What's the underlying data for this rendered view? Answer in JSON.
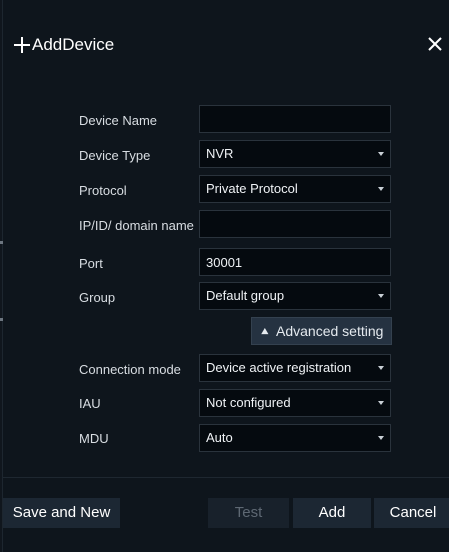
{
  "dialog": {
    "title": "AddDevice",
    "plus_icon": "plus-icon",
    "close_icon": "close-icon"
  },
  "form": {
    "device_name": {
      "label": "Device Name",
      "value": ""
    },
    "device_type": {
      "label": "Device Type",
      "value": "NVR"
    },
    "protocol": {
      "label": "Protocol",
      "value": "Private Protocol"
    },
    "ip_domain": {
      "label": "IP/ID/ domain name",
      "value": ""
    },
    "port": {
      "label": "Port",
      "value": "30001"
    },
    "group": {
      "label": "Group",
      "value": "Default group"
    },
    "advanced_setting": {
      "label": "Advanced setting",
      "icon": "double-chevron-up-icon"
    },
    "connection_mode": {
      "label": "Connection mode",
      "value": "Device active registration"
    },
    "iau": {
      "label": "IAU",
      "value": "Not configured"
    },
    "mdu": {
      "label": "MDU",
      "value": "Auto"
    }
  },
  "footer": {
    "save_and_new": "Save and New",
    "test": "Test",
    "add": "Add",
    "cancel": "Cancel"
  },
  "colors": {
    "background": "#0e151c",
    "field_background": "#050a0f",
    "field_border": "#2a333c",
    "button_background": "#1c2733",
    "advanced_button_background": "#253241",
    "disabled_text": "#5e6873"
  }
}
